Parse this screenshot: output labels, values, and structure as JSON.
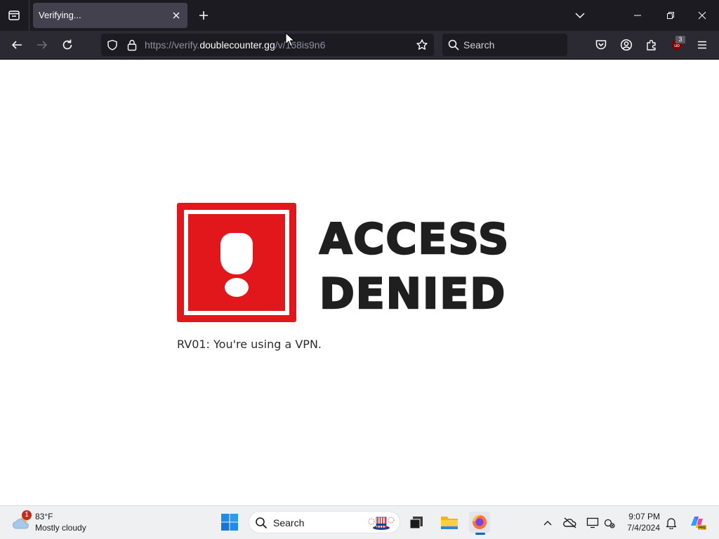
{
  "browser": {
    "tab": {
      "title": "Verifying...",
      "close_glyph": "✕"
    },
    "new_tab_glyph": "+",
    "url": {
      "scheme_prefix": "https://verify.",
      "host": "doublecounter.gg",
      "path": "/v/168is9n6"
    },
    "search_placeholder": "Search",
    "ublock_badge": "3",
    "icons": {
      "tab_list": "tab-list-icon",
      "back": "back-arrow-icon",
      "forward": "forward-arrow-icon",
      "reload": "reload-icon",
      "shield": "tracking-shield-icon",
      "lock": "lock-icon",
      "bookmark": "bookmark-star-icon",
      "pocket": "pocket-icon",
      "account": "account-icon",
      "extensions": "extensions-icon",
      "ublock": "ublock-origin-icon",
      "menu": "hamburger-menu-icon"
    }
  },
  "page": {
    "headline_line1": "ACCESS",
    "headline_line2": "DENIED",
    "error_message": "RV01: You're using a VPN.",
    "accent_color": "#e2171c"
  },
  "taskbar": {
    "weather": {
      "badge": "1",
      "temperature": "83°F",
      "condition": "Mostly cloudy"
    },
    "search_placeholder": "Search",
    "clock": {
      "time": "9:07 PM",
      "date": "7/4/2024"
    },
    "apps": [
      "start",
      "task-view",
      "file-explorer",
      "firefox"
    ]
  }
}
